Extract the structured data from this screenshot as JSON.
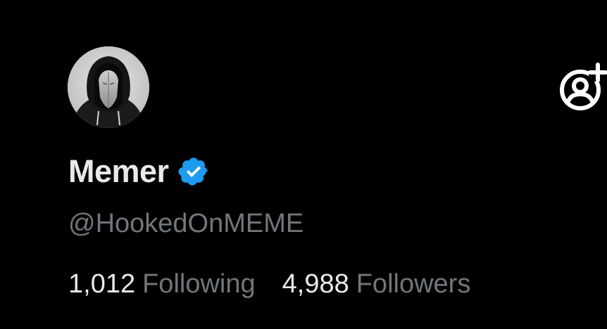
{
  "profile": {
    "display_name": "Memer",
    "handle": "@HookedOnMEME",
    "verified": true,
    "avatar_icon": "hooded-masked-figure-avatar",
    "follow_icon": "add-user-icon",
    "verified_icon": "verified-badge-icon"
  },
  "stats": {
    "following_count": "1,012",
    "following_label": "Following",
    "followers_count": "4,988",
    "followers_label": "Followers"
  },
  "colors": {
    "background": "#000000",
    "primary_text": "#e7e9ea",
    "secondary_text": "#71767b",
    "verified_blue": "#1d9bf0",
    "icon_white": "#ffffff"
  }
}
